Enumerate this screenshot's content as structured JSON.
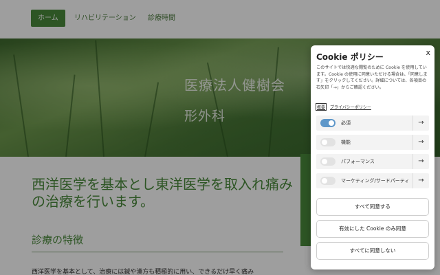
{
  "nav": {
    "items": [
      {
        "label": "ホーム",
        "active": true
      },
      {
        "label": "リハビリテーション",
        "active": false
      },
      {
        "label": "診療時間",
        "active": false
      }
    ]
  },
  "hero": {
    "title": "医療法人健樹会",
    "subtitle": "形外科"
  },
  "main": {
    "headline": "西洋医学を基本とし東洋医学を取入れ痛みの治療を行います。",
    "section_title": "診療の特徴",
    "body_text": "西洋医学を基本として、治療には鍼や漢方も積極的に用い、できるだけ早く痛み"
  },
  "cookie": {
    "title": "Cookie ポリシー",
    "close": "x",
    "description": "このサイトでは快適な閲覧のために Cookie を使用しています。Cookie の使用に同意いただける場合は、「同意します」をクリックしてください。詳細については、各項目の右矢印「→」からご確認ください。",
    "details_link": "概要",
    "privacy_link": "プライバシーポリシー",
    "categories": [
      {
        "label": "必須",
        "enabled": true,
        "arrow": "→"
      },
      {
        "label": "機能",
        "enabled": false,
        "arrow": "→"
      },
      {
        "label": "パフォーマンス",
        "enabled": false,
        "arrow": "→"
      },
      {
        "label": "マーケティング/サードパーティ",
        "enabled": false,
        "arrow": "→"
      }
    ],
    "buttons": {
      "accept_all": "すべて同意する",
      "accept_enabled": "有効にした Cookie のみ同意",
      "reject_all": "すべてに同意しない"
    }
  },
  "colors": {
    "brand_green": "#4a8a3a",
    "toggle_on": "#5e97c9"
  }
}
